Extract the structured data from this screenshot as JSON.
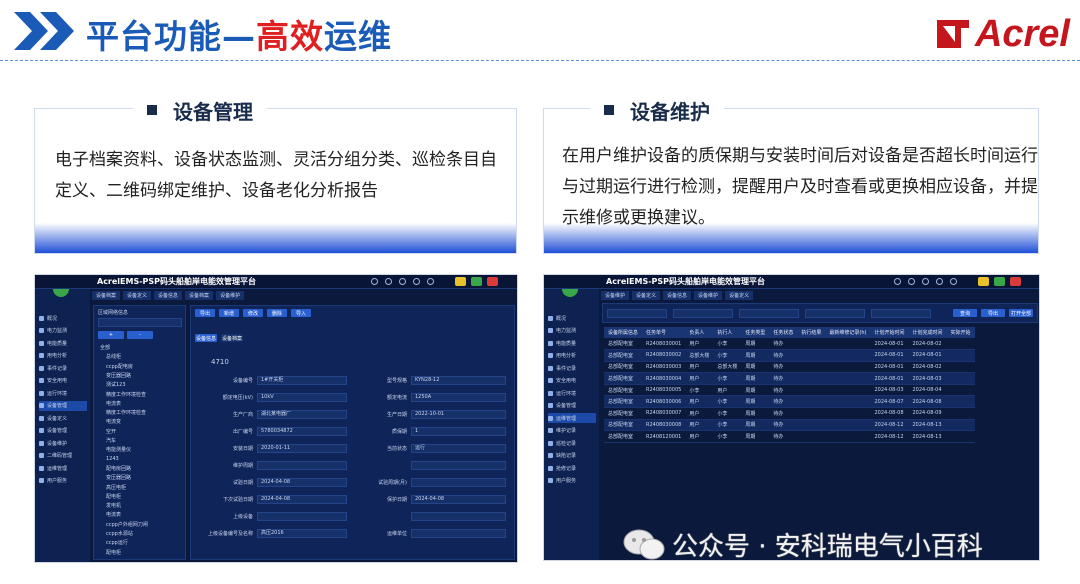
{
  "header": {
    "title_pre": "平台功能—",
    "title_hl": "高效",
    "title_post": "运维",
    "logo_text": "Acrel",
    "colors": {
      "blue": "#1a5bb8",
      "red": "#e02020",
      "logo": "#c4161c"
    }
  },
  "left_card": {
    "title": "设备管理",
    "text": "电子档案资料、设备状态监测、灵活分组分类、巡检条目自定义、二维码绑定维护、设备老化分析报告"
  },
  "right_card": {
    "title": "设备维护",
    "text": "在用户维护设备的质保期与安装时间后对设备是否超长时间运行与过期运行进行检测，提醒用户及时查看或更换相应设备，并提示维修或更换建议。"
  },
  "shot1": {
    "app_title": "AcrelEMS-PSP码头船舶岸电能效管理平台",
    "sidebar": [
      "概况",
      "电力监测",
      "电能质量",
      "用电分析",
      "事件记录",
      "安全用电",
      "运行环境",
      "设备管理",
      "设备定义",
      "设备管理",
      "设备维护",
      "二维码管理",
      "运维管理",
      "用户服务"
    ],
    "tabs": [
      "设备档案",
      "设备定义",
      "设备信息",
      "设备档案",
      "设备维护"
    ],
    "filter_label": "区域网络信息",
    "tree": [
      "全部",
      "总线柜",
      "ccpp配电房",
      "变压器回路",
      "测试123",
      "精度工作环境检查",
      "电流表",
      "精度工作环境检查",
      "电流变",
      "空开",
      "汽车",
      "电能测量仪",
      "1243",
      "配电房回路",
      "变压器回路",
      "高压电柜",
      "配电柜",
      "发电机",
      "电流表",
      "ccpp户外组网刀闸",
      "ccpp水源站",
      "ccpp运行",
      "配电柜"
    ],
    "form_tabs": [
      "设备信息",
      "设备档案"
    ],
    "device_id": "4710",
    "fields": [
      "设备编号",
      "额定电压(kV)",
      "生产厂商",
      "出厂编号",
      "安装日期",
      "维护周期",
      "试验日期",
      "下次试验日期",
      "上级设备",
      "上级设备编号及名称"
    ],
    "values": [
      "1#开关柜",
      "10kV",
      "湖北某电器厂",
      "5780034872",
      "2020-01-11",
      "",
      "2024-04-08",
      "2024-04-08",
      "",
      "高压2016"
    ],
    "fields_r": [
      "型号规格",
      "额定电流",
      "生产日期",
      "质保期",
      "当前状态",
      "",
      "试验周期(月)",
      "保护日期",
      "",
      "运维单位"
    ],
    "values_r": [
      "KYN28-12",
      "1250A",
      "2022-10-01",
      "1",
      "运行",
      "",
      "",
      "2024-04-08",
      "",
      ""
    ],
    "buttons": [
      "导出",
      "新增",
      "修改",
      "删除",
      "导入"
    ]
  },
  "shot2": {
    "app_title": "AcrelEMS-PSP码头船舶岸电能效管理平台",
    "sidebar": [
      "概况",
      "电力监测",
      "电能质量",
      "用电分析",
      "事件记录",
      "安全用电",
      "运行环境",
      "设备管理",
      "运维管理",
      "维护记录",
      "巡检记录",
      "缺陷记录",
      "抢修记录",
      "用户服务"
    ],
    "tabs": [
      "设备维护",
      "设备定义",
      "设备信息",
      "设备维护",
      "设备定义"
    ],
    "buttons": [
      "查询",
      "导出",
      "打开全部"
    ],
    "columns": [
      "设备所属信息",
      "任务单号",
      "负责人",
      "执行人",
      "任务类型",
      "任务状态",
      "执行结果",
      "最新维修记录(h)",
      "计划开始时间",
      "计划完成时间",
      "实际开始"
    ],
    "rows": [
      [
        "总部配电室",
        "R2408030001",
        "用户",
        "小李",
        "周期",
        "待办",
        "",
        "",
        "2024-08-01",
        "2024-08-02",
        ""
      ],
      [
        "总部配电室",
        "R2408030002",
        "总部大楼",
        "小李",
        "周期",
        "待办",
        "",
        "",
        "2024-08-01",
        "2024-08-01",
        ""
      ],
      [
        "总部配电室",
        "R2408030003",
        "用户",
        "总部大楼",
        "周期",
        "待办",
        "",
        "",
        "2024-08-01",
        "2024-08-02",
        ""
      ],
      [
        "总部配电室",
        "R2408030004",
        "用户",
        "小李",
        "周期",
        "待办",
        "",
        "",
        "2024-08-01",
        "2024-08-03",
        ""
      ],
      [
        "总部配电室",
        "R2408030005",
        "小李",
        "用户",
        "周期",
        "待办",
        "",
        "",
        "2024-08-03",
        "2024-08-04",
        ""
      ],
      [
        "总部配电室",
        "R2408030006",
        "用户",
        "小李",
        "周期",
        "待办",
        "",
        "",
        "2024-08-07",
        "2024-08-08",
        ""
      ],
      [
        "总部配电室",
        "R2408030007",
        "用户",
        "小李",
        "周期",
        "待办",
        "",
        "",
        "2024-08-08",
        "2024-08-09",
        ""
      ],
      [
        "总部配电室",
        "R2408030008",
        "用户",
        "小李",
        "周期",
        "待办",
        "",
        "",
        "2024-08-12",
        "2024-08-13",
        ""
      ],
      [
        "总部配电室",
        "R2408120001",
        "用户",
        "小李",
        "周期",
        "待办",
        "",
        "",
        "2024-08-12",
        "2024-08-13",
        ""
      ]
    ]
  },
  "watermark": "公众号 · 安科瑞电气小百科"
}
